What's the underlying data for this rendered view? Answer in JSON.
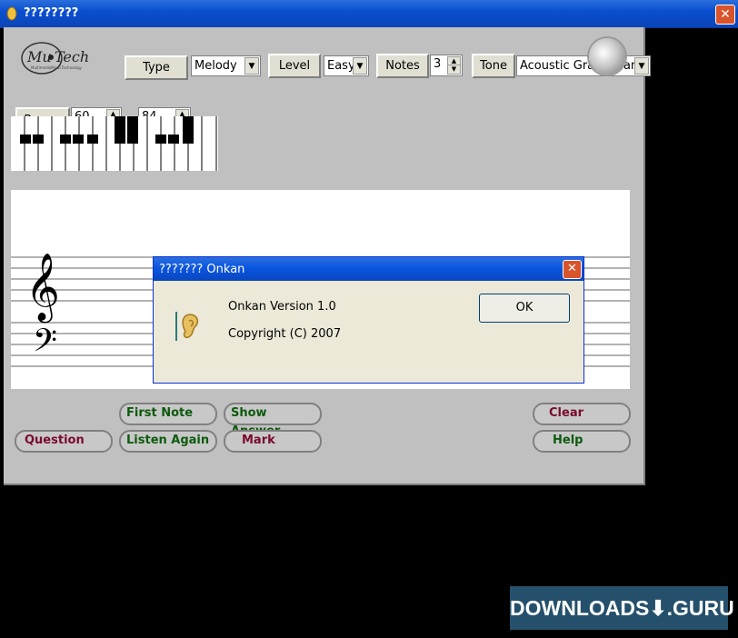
{
  "window": {
    "title": "????????"
  },
  "logo": {
    "text": "MusicTech"
  },
  "controls": {
    "type_label": "Type",
    "type_value": "Melody",
    "level_label": "Level",
    "level_value": "Easy",
    "notes_label": "Notes",
    "notes_value": "3",
    "tone_label": "Tone",
    "tone_value": "Acoustic Grand Piano",
    "range_label": "Range",
    "range_low": "60",
    "range_high": "84"
  },
  "buttons": {
    "first_note": "First Note",
    "show_answer": "Show Answer",
    "clear": "Clear",
    "question": "Question",
    "listen_again": "Listen Again",
    "mark": "Mark",
    "help": "Help"
  },
  "dialog": {
    "title": "??????? Onkan",
    "version": "Onkan Version 1.0",
    "copyright": "Copyright (C) 2007",
    "ok_label": "OK"
  },
  "watermark": {
    "text": "DOWNLOADS⬇.GURU"
  },
  "colors": {
    "titlebar": "#0a4fd0",
    "panel": "#c0c0c0",
    "dialog": "#ece9d8",
    "green_text": "#0d5a0d",
    "maroon_text": "#7a0a2c",
    "watermark_bg": "#25506b"
  }
}
